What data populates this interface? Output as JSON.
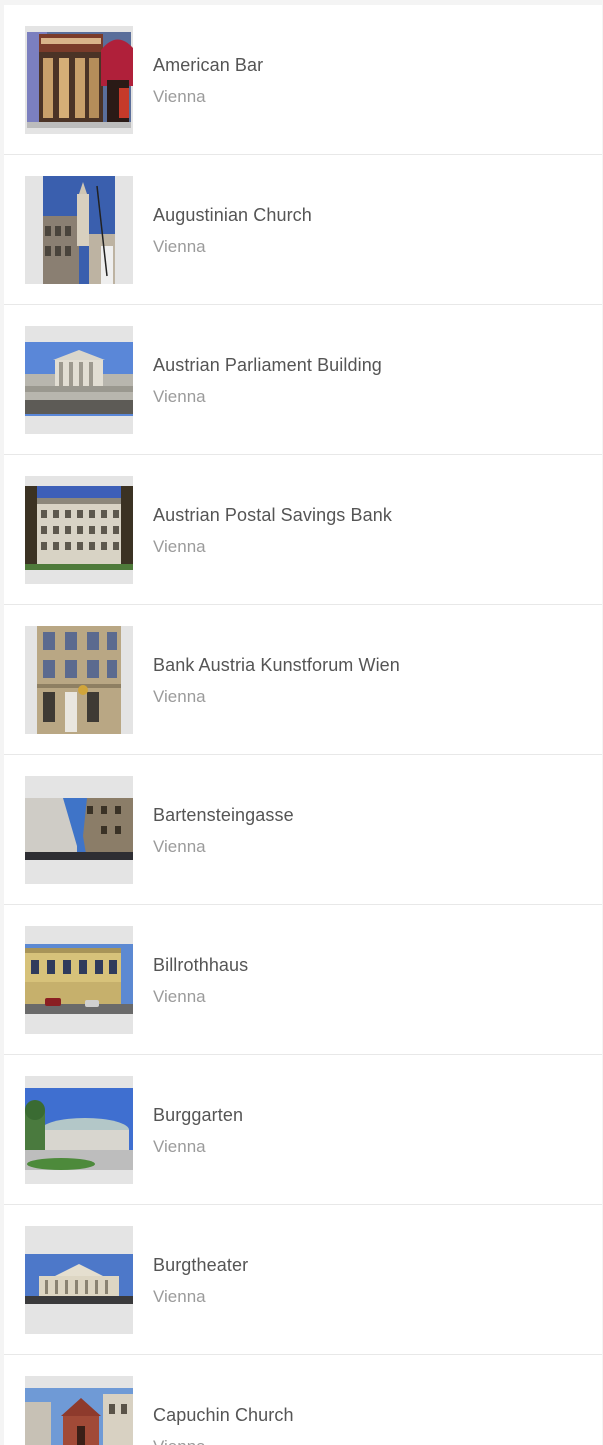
{
  "places": [
    {
      "name": "American Bar",
      "city": "Vienna",
      "image": "american-bar-photo"
    },
    {
      "name": "Augustinian Church",
      "city": "Vienna",
      "image": "augustinian-church-photo"
    },
    {
      "name": "Austrian Parliament Building",
      "city": "Vienna",
      "image": "parliament-photo"
    },
    {
      "name": "Austrian Postal Savings Bank",
      "city": "Vienna",
      "image": "postal-savings-bank-photo"
    },
    {
      "name": "Bank Austria Kunstforum Wien",
      "city": "Vienna",
      "image": "kunstforum-photo"
    },
    {
      "name": "Bartensteingasse",
      "city": "Vienna",
      "image": "bartensteingasse-photo"
    },
    {
      "name": "Billrothhaus",
      "city": "Vienna",
      "image": "billrothhaus-photo"
    },
    {
      "name": "Burggarten",
      "city": "Vienna",
      "image": "burggarten-photo"
    },
    {
      "name": "Burgtheater",
      "city": "Vienna",
      "image": "burgtheater-photo"
    },
    {
      "name": "Capuchin Church",
      "city": "Vienna",
      "image": "capuchin-church-photo"
    }
  ]
}
